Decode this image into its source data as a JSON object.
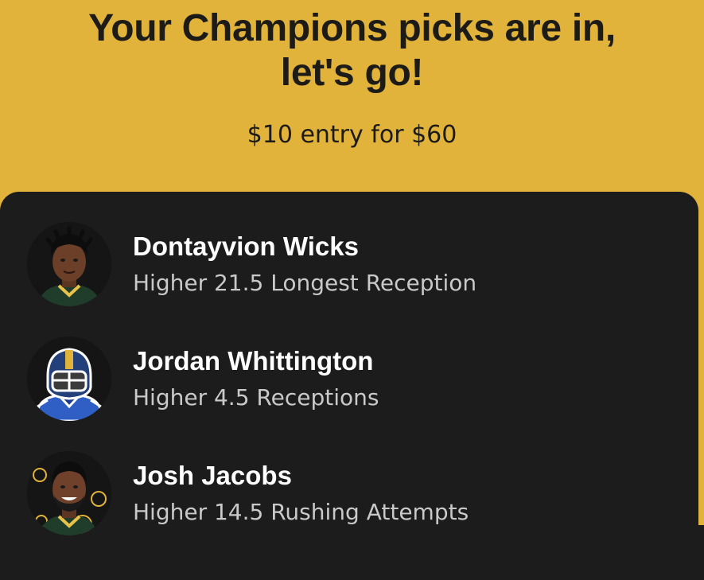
{
  "header": {
    "title_line1": "Your Champions picks are in,",
    "title_line2": "let's go!",
    "entry_text": "$10 entry for $60"
  },
  "picks": [
    {
      "player": "Dontayvion Wicks",
      "pick": "Higher 21.5 Longest Reception",
      "avatar": "player-photo"
    },
    {
      "player": "Jordan Whittington",
      "pick": "Higher 4.5 Receptions",
      "avatar": "football-helmet-icon"
    },
    {
      "player": "Josh Jacobs",
      "pick": "Higher 14.5 Rushing Attempts",
      "avatar": "player-photo"
    }
  ],
  "colors": {
    "background": "#e2b33a",
    "card": "#1c1c1c",
    "title": "#1c1b18",
    "name": "#ffffff",
    "pick": "#c9c9c9"
  }
}
